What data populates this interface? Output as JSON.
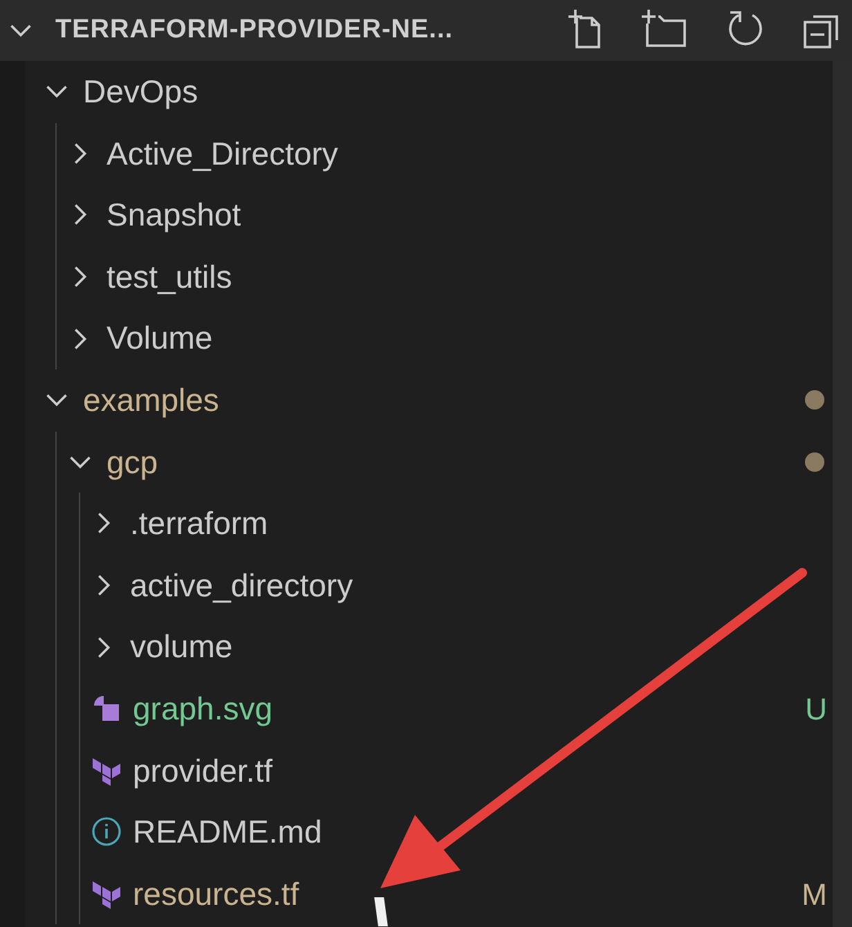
{
  "header": {
    "title": "TERRAFORM-PROVIDER-NE...",
    "expanded": true
  },
  "tree": [
    {
      "kind": "folder",
      "name": "DevOps",
      "expanded": true,
      "color": "#cccccc",
      "dot": false,
      "children": [
        {
          "kind": "folder",
          "name": "Active_Directory",
          "expanded": false,
          "color": "#cccccc",
          "dot": false
        },
        {
          "kind": "folder",
          "name": "Snapshot",
          "expanded": false,
          "color": "#cccccc",
          "dot": false
        },
        {
          "kind": "folder",
          "name": "test_utils",
          "expanded": false,
          "color": "#cccccc",
          "dot": false
        },
        {
          "kind": "folder",
          "name": "Volume",
          "expanded": false,
          "color": "#cccccc",
          "dot": false
        }
      ]
    },
    {
      "kind": "folder",
      "name": "examples",
      "expanded": true,
      "color": "#c9b48f",
      "dot": true,
      "children": [
        {
          "kind": "folder",
          "name": "gcp",
          "expanded": true,
          "color": "#c9b48f",
          "dot": true,
          "children": [
            {
              "kind": "folder",
              "name": ".terraform",
              "expanded": false,
              "color": "#cccccc",
              "dot": false
            },
            {
              "kind": "folder",
              "name": "active_directory",
              "expanded": false,
              "color": "#cccccc",
              "dot": false
            },
            {
              "kind": "folder",
              "name": "volume",
              "expanded": false,
              "color": "#cccccc",
              "dot": false
            },
            {
              "kind": "svg",
              "name": "graph.svg",
              "color": "#73c991",
              "badge": "U"
            },
            {
              "kind": "terraform",
              "name": "provider.tf",
              "color": "#cccccc"
            },
            {
              "kind": "info",
              "name": "README.md",
              "color": "#cccccc"
            },
            {
              "kind": "terraform",
              "name": "resources.tf",
              "color": "#c9b48f",
              "badge": "M"
            }
          ]
        }
      ]
    }
  ]
}
